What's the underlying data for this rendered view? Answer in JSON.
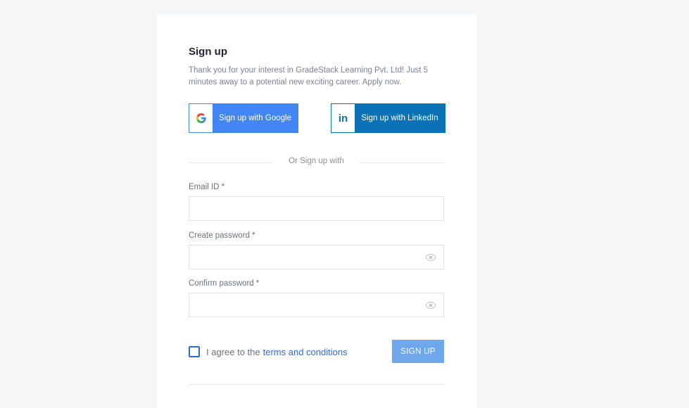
{
  "signup": {
    "title": "Sign up",
    "subtitle": "Thank you for your interest in GradeStack Learning Pvt. Ltd! Just 5 minutes away to a potential new exciting career. Apply now.",
    "google_label": "Sign up with Google",
    "linkedin_label": "Sign up with LinkedIn",
    "divider_text": "Or Sign up with",
    "email_label": "Email ID *",
    "email_value": "",
    "create_password_label": "Create password *",
    "create_password_value": "",
    "confirm_password_label": "Confirm password *",
    "confirm_password_value": "",
    "agree_text": "I agree to the",
    "terms_link": "terms and conditions",
    "signup_button": "SIGN UP",
    "agree_checked": false
  },
  "icons": {
    "google": "google-icon",
    "linkedin": "linkedin-icon",
    "eye": "eye-icon",
    "checkbox": "checkbox-unchecked"
  },
  "colors": {
    "google_blue": "#4285f4",
    "linkedin_blue": "#0a72b5",
    "link_blue": "#2f6cd0",
    "signup_button": "#6ea7ec",
    "background": "#f5f6f8"
  }
}
